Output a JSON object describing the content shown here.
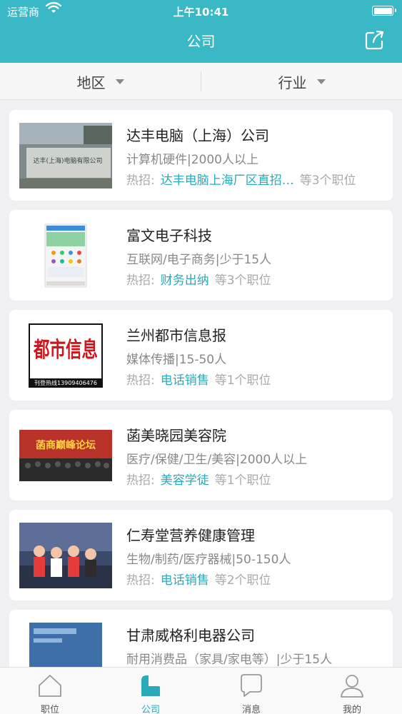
{
  "status_bar": {
    "carrier": "运营商",
    "time": "上午10:41"
  },
  "nav": {
    "title": "公司"
  },
  "filters": {
    "region": "地区",
    "industry": "行业"
  },
  "companies": [
    {
      "name": "达丰电脑（上海）公司",
      "meta": "计算机硬件|2000人以上",
      "hot_prefix": "热招:",
      "hot_job": "达丰电脑上海厂区直招…",
      "hot_more": "等3个职位",
      "logo_text": "达丰(上海)电脑有限公司"
    },
    {
      "name": "富文电子科技",
      "meta": "互联网/电子商务|少于15人",
      "hot_prefix": "热招:",
      "hot_job": "财务出纳",
      "hot_more": "等3个职位"
    },
    {
      "name": "兰州都市信息报",
      "meta": "媒体传播|15-50人",
      "hot_prefix": "热招:",
      "hot_job": "电话销售",
      "hot_more": "等1个职位",
      "logo_text": "都市信息",
      "logo_subtext": "刊登热线13909406476"
    },
    {
      "name": "菡美晓园美容院",
      "meta": "医疗/保健/卫生/美容|2000人以上",
      "hot_prefix": "热招:",
      "hot_job": "美容学徒",
      "hot_more": "等1个职位",
      "logo_text": "菡商巅峰论坛"
    },
    {
      "name": "仁寿堂营养健康管理",
      "meta": "生物/制药/医疗器械|50-150人",
      "hot_prefix": "热招:",
      "hot_job": "电话销售",
      "hot_more": "等2个职位"
    },
    {
      "name": "甘肃威格利电器公司",
      "meta": "耐用消费品（家具/家电等）|少于15人"
    }
  ],
  "tabs": [
    {
      "label": "职位",
      "icon": "home-icon",
      "active": false
    },
    {
      "label": "公司",
      "icon": "company-icon",
      "active": true
    },
    {
      "label": "消息",
      "icon": "chat-icon",
      "active": false
    },
    {
      "label": "我的",
      "icon": "user-icon",
      "active": false
    }
  ],
  "colors": {
    "accent": "#3ab8c6",
    "link": "#2aa9b8",
    "background": "#efeff4"
  }
}
